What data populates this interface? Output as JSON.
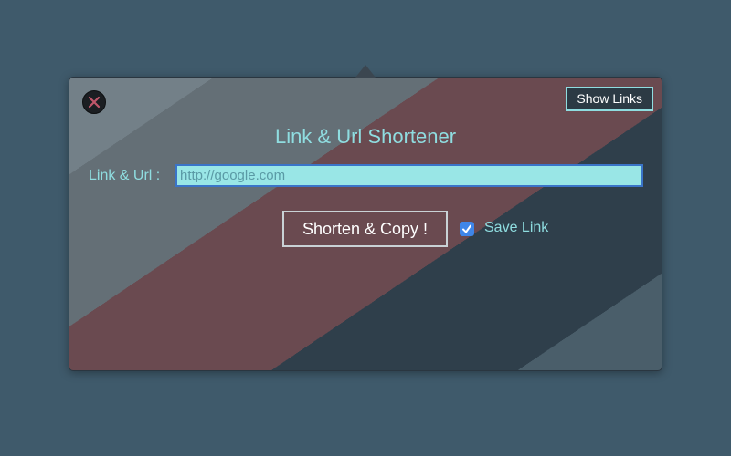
{
  "window": {
    "title": "Link & Url Shortener"
  },
  "toolbar": {
    "show_links_label": "Show Links"
  },
  "form": {
    "url_label": "Link & Url :",
    "url_value": "",
    "url_placeholder": "http://google.com",
    "shorten_label": "Shorten & Copy !",
    "save_link_label": "Save Link",
    "save_link_checked": true
  },
  "icons": {
    "close": "close-icon",
    "check": "checkmark-icon"
  },
  "colors": {
    "accent_text": "#8fdde0",
    "input_bg": "#99e6e6",
    "focus_border": "#3a74c8",
    "checkbox": "#3f86e8",
    "close_x": "#c0566a"
  }
}
